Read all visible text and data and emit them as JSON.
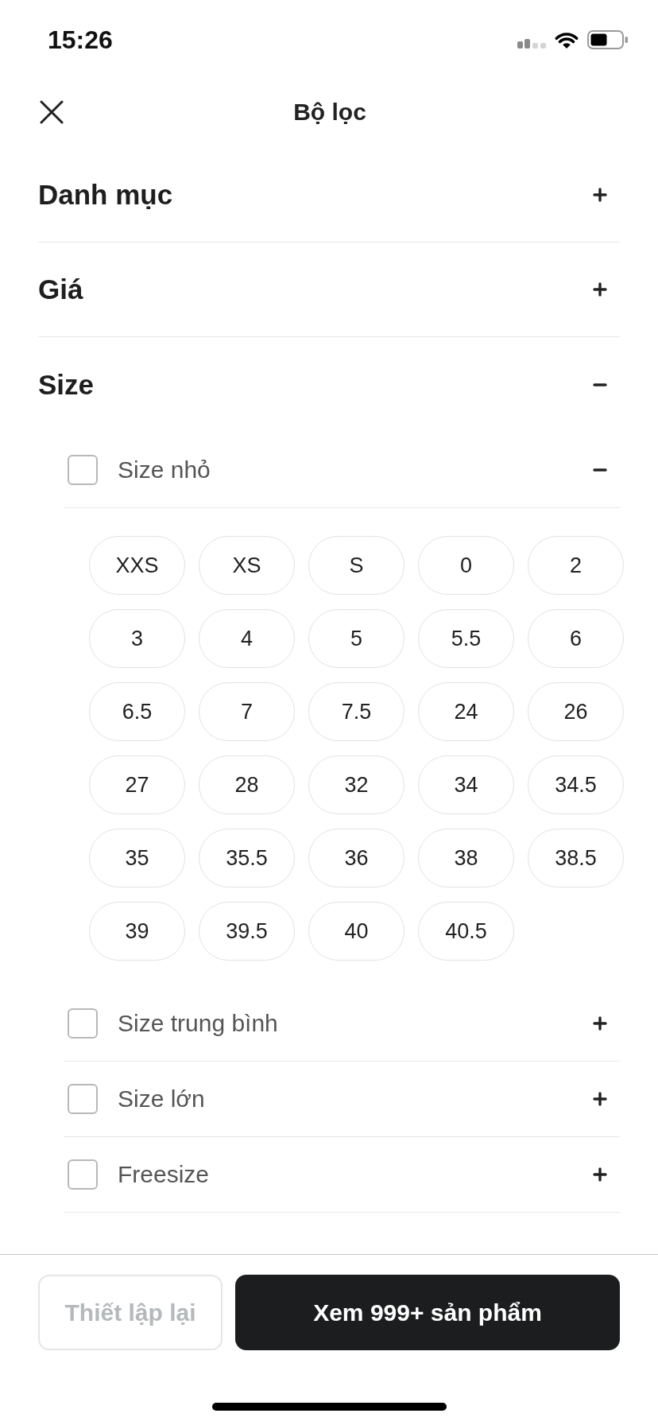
{
  "status_bar": {
    "time": "15:26"
  },
  "header": {
    "title": "Bộ lọc"
  },
  "sections": [
    {
      "title": "Danh mục",
      "expanded": false
    },
    {
      "title": "Giá",
      "expanded": false
    },
    {
      "title": "Size",
      "expanded": true,
      "groups": [
        {
          "label": "Size nhỏ",
          "checked": false,
          "expanded": true,
          "options": [
            {
              "label": "XXS",
              "selected": false
            },
            {
              "label": "XS",
              "selected": false
            },
            {
              "label": "S",
              "selected": false
            },
            {
              "label": "0",
              "selected": false
            },
            {
              "label": "2",
              "selected": false
            },
            {
              "label": "3",
              "selected": false
            },
            {
              "label": "4",
              "selected": false
            },
            {
              "label": "5",
              "selected": false
            },
            {
              "label": "5.5",
              "selected": false
            },
            {
              "label": "6",
              "selected": false
            },
            {
              "label": "6.5",
              "selected": false
            },
            {
              "label": "7",
              "selected": false
            },
            {
              "label": "7.5",
              "selected": false
            },
            {
              "label": "24",
              "selected": false
            },
            {
              "label": "26",
              "selected": false
            },
            {
              "label": "27",
              "selected": false
            },
            {
              "label": "28",
              "selected": false
            },
            {
              "label": "32",
              "selected": false
            },
            {
              "label": "34",
              "selected": false
            },
            {
              "label": "34.5",
              "selected": false
            },
            {
              "label": "35",
              "selected": false
            },
            {
              "label": "35.5",
              "selected": false
            },
            {
              "label": "36",
              "selected": false
            },
            {
              "label": "38",
              "selected": false
            },
            {
              "label": "38.5",
              "selected": false
            },
            {
              "label": "39",
              "selected": false
            },
            {
              "label": "39.5",
              "selected": false
            },
            {
              "label": "40",
              "selected": false
            },
            {
              "label": "40.5",
              "selected": false
            }
          ]
        },
        {
          "label": "Size trung bình",
          "checked": false,
          "expanded": false
        },
        {
          "label": "Size lớn",
          "checked": false,
          "expanded": false
        },
        {
          "label": "Freesize",
          "checked": false,
          "expanded": false
        }
      ]
    }
  ],
  "footer": {
    "reset_button": {
      "label": "Thiết lập lại",
      "disabled": true
    },
    "apply_button": {
      "label": "Xem 999+ sản phẩm"
    }
  }
}
